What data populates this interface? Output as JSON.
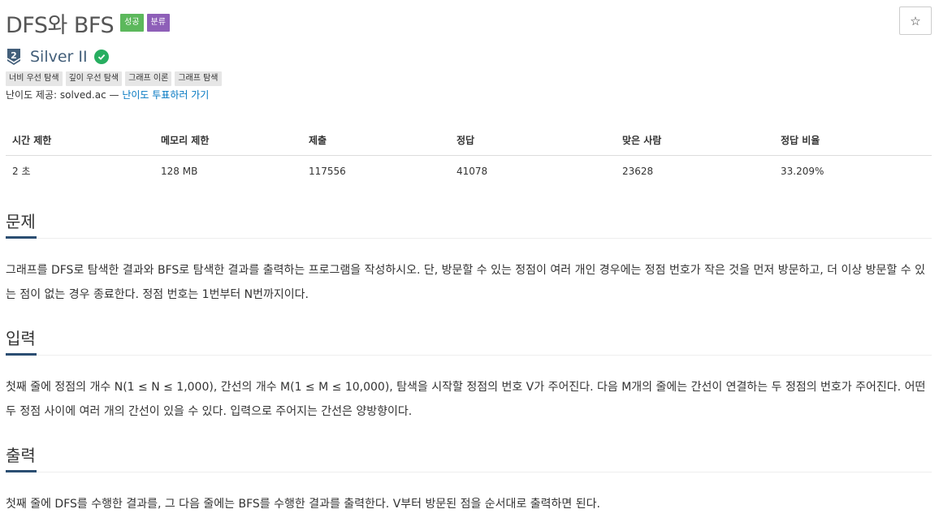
{
  "problem": {
    "title": "DFS와 BFS",
    "badges": [
      {
        "label": "성공",
        "color": "#5cb85c"
      },
      {
        "label": "분류",
        "color": "#8e5fb8"
      }
    ],
    "star_icon": "☆",
    "tier": {
      "number": "2",
      "name": "Silver II",
      "color": "#435f7a"
    },
    "tags": [
      "너비 우선 탐색",
      "깊이 우선 탐색",
      "그래프 이론",
      "그래프 탐색"
    ],
    "credit": {
      "prefix": "난이도 제공: solved.ac —",
      "link": "난이도 투표하러 가기"
    }
  },
  "info_table": {
    "headers": [
      "시간 제한",
      "메모리 제한",
      "제출",
      "정답",
      "맞은 사람",
      "정답 비율"
    ],
    "row": [
      "2 초",
      "128 MB",
      "117556",
      "41078",
      "23628",
      "33.209%"
    ]
  },
  "sections": {
    "description": {
      "heading": "문제",
      "text": "그래프를 DFS로 탐색한 결과와 BFS로 탐색한 결과를 출력하는 프로그램을 작성하시오. 단, 방문할 수 있는 정점이 여러 개인 경우에는 정점 번호가 작은 것을 먼저 방문하고, 더 이상 방문할 수 있는 점이 없는 경우 종료한다. 정점 번호는 1번부터 N번까지이다."
    },
    "input": {
      "heading": "입력",
      "text": "첫째 줄에 정점의 개수 N(1 ≤ N ≤ 1,000), 간선의 개수 M(1 ≤ M ≤ 10,000), 탐색을 시작할 정점의 번호 V가 주어진다. 다음 M개의 줄에는 간선이 연결하는 두 정점의 번호가 주어진다. 어떤 두 정점 사이에 여러 개의 간선이 있을 수 있다. 입력으로 주어지는 간선은 양방향이다."
    },
    "output": {
      "heading": "출력",
      "text": "첫째 줄에 DFS를 수행한 결과를, 그 다음 줄에는 BFS를 수행한 결과를 출력한다. V부터 방문된 점을 순서대로 출력하면 된다."
    }
  }
}
